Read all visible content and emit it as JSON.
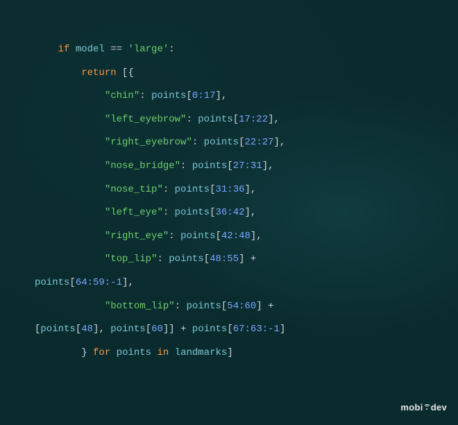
{
  "code": {
    "l1": {
      "if": "if",
      "model": "model",
      "eq": " == ",
      "large": "'large'",
      "colon": ":"
    },
    "l2": {
      "return": "return",
      "open": " [{"
    },
    "l3": {
      "key": "\"chin\"",
      "colon": ": ",
      "points": "points",
      "lb": "[",
      "slice": "0:17",
      "rb": "],"
    },
    "l4": {
      "key": "\"left_eyebrow\"",
      "colon": ": ",
      "points": "points",
      "lb": "[",
      "slice": "17:22",
      "rb": "],"
    },
    "l5": {
      "key": "\"right_eyebrow\"",
      "colon": ": ",
      "points": "points",
      "lb": "[",
      "slice": "22:27",
      "rb": "],"
    },
    "l6": {
      "key": "\"nose_bridge\"",
      "colon": ": ",
      "points": "points",
      "lb": "[",
      "slice": "27:31",
      "rb": "],"
    },
    "l7": {
      "key": "\"nose_tip\"",
      "colon": ": ",
      "points": "points",
      "lb": "[",
      "slice": "31:36",
      "rb": "],"
    },
    "l8": {
      "key": "\"left_eye\"",
      "colon": ": ",
      "points": "points",
      "lb": "[",
      "slice": "36:42",
      "rb": "],"
    },
    "l9": {
      "key": "\"right_eye\"",
      "colon": ": ",
      "points": "points",
      "lb": "[",
      "slice": "42:48",
      "rb": "],"
    },
    "l10": {
      "key": "\"top_lip\"",
      "colon": ": ",
      "points": "points",
      "lb": "[",
      "slice": "48:55",
      "rb": "] +"
    },
    "l11": {
      "points": "points",
      "lb": "[",
      "slice": "64:59:-1",
      "rb": "],"
    },
    "l12": {
      "key": "\"bottom_lip\"",
      "colon": ": ",
      "points": "points",
      "lb": "[",
      "slice": "54:60",
      "rb": "] +"
    },
    "l13": {
      "lb1": "[",
      "points1": "points",
      "lb2": "[",
      "n48": "48",
      "rb2": "], ",
      "points2": "points",
      "lb3": "[",
      "n60": "60",
      "rb3": "]] + ",
      "points3": "points",
      "lb4": "[",
      "slice": "67:63:-1",
      "rb4": "]"
    },
    "l14": {
      "close": "} ",
      "for": "for",
      "sp1": " ",
      "points": "points",
      "sp2": " ",
      "in": "in",
      "sp3": " ",
      "landmarks": "landmarks",
      "rb": "]"
    }
  },
  "logo": {
    "text_a": "mobi",
    "text_b": "dev"
  }
}
